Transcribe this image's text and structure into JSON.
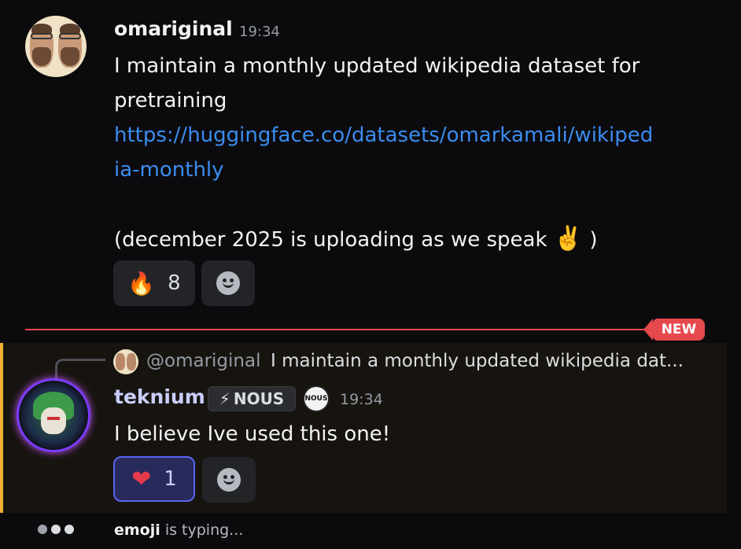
{
  "message1": {
    "username": "omariginal",
    "time": "19:34",
    "lines": [
      "I maintain a monthly updated wikipedia dataset for",
      "pretraining"
    ],
    "link_lines": [
      "https://huggingface.co/datasets/omarkamali/wikiped",
      "ia-monthly"
    ],
    "closing_text": "(december 2025 is uploading as we speak",
    "closing_emoji": "✌️",
    "closing_paren": ")",
    "reaction": {
      "emoji": "🔥",
      "count": "8"
    }
  },
  "divider": {
    "label": "NEW",
    "color": "#e5484d"
  },
  "message2": {
    "reply": {
      "user": "@omariginal",
      "text": "I maintain a monthly updated wikipedia dat..."
    },
    "username": "teknium",
    "tag": "NOUS",
    "tag_icon": "bolt-icon",
    "server_badge": "NOUS",
    "time": "19:34",
    "text": "I believe Ive used this one!",
    "reaction": {
      "emoji": "❤",
      "count": "1"
    }
  },
  "typing": {
    "user": "emoji",
    "text": "is typing..."
  },
  "colors": {
    "accent": "#5865f2",
    "link": "#3b8cf0",
    "highlight_border": "#f0b232"
  }
}
